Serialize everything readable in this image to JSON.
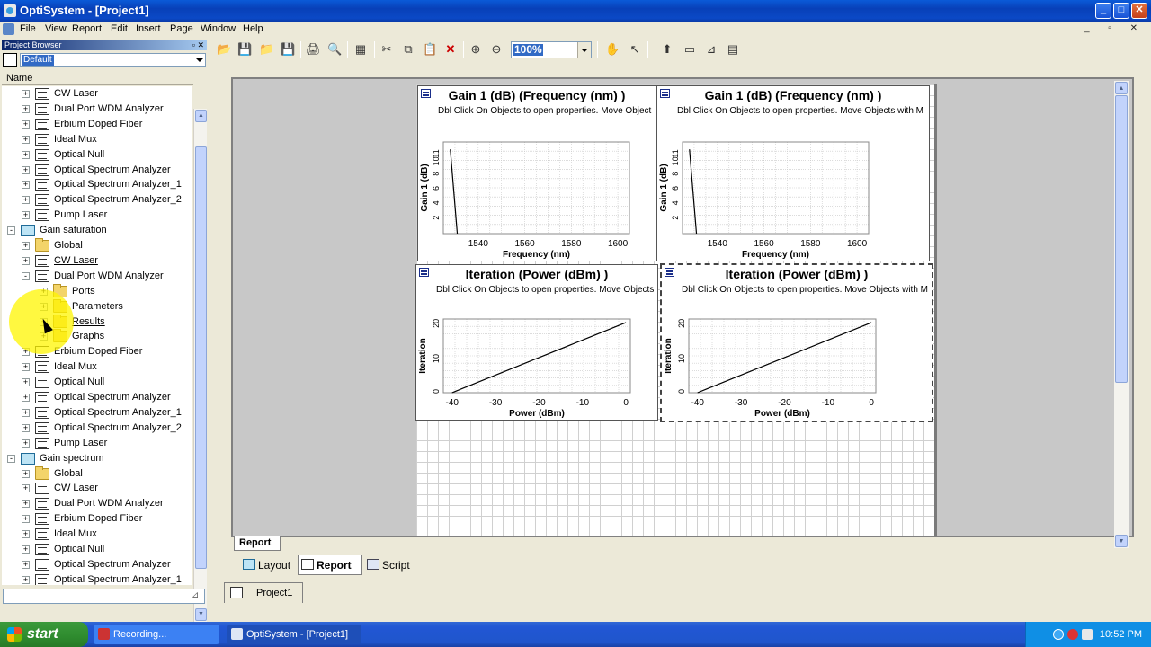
{
  "window": {
    "title": "OptiSystem - [Project1]"
  },
  "menu": [
    "File",
    "View",
    "Report",
    "Edit",
    "Insert",
    "Page",
    "Window",
    "Help"
  ],
  "browser": {
    "title": "Project Browser",
    "combo_value": "Default",
    "header": "Name",
    "rows": [
      {
        "label": "CW Laser",
        "level": 1,
        "icon": "laser-icon",
        "exp": "+"
      },
      {
        "label": "Dual Port WDM Analyzer",
        "level": 1,
        "icon": "analyzer-icon",
        "exp": "+"
      },
      {
        "label": "Erbium Doped Fiber",
        "level": 1,
        "icon": "fiber-icon",
        "exp": "+"
      },
      {
        "label": "Ideal Mux",
        "level": 1,
        "icon": "mux-icon",
        "exp": "+"
      },
      {
        "label": "Optical Null",
        "level": 1,
        "icon": "null-icon",
        "exp": "+"
      },
      {
        "label": "Optical Spectrum Analyzer",
        "level": 1,
        "icon": "analyzer-icon",
        "exp": "+"
      },
      {
        "label": "Optical Spectrum Analyzer_1",
        "level": 1,
        "icon": "analyzer-icon",
        "exp": "+"
      },
      {
        "label": "Optical Spectrum Analyzer_2",
        "level": 1,
        "icon": "analyzer-icon",
        "exp": "+"
      },
      {
        "label": "Pump Laser",
        "level": 1,
        "icon": "laser-icon",
        "exp": "+"
      },
      {
        "label": "Gain saturation",
        "level": 0,
        "icon": "layout-icon",
        "exp": "-"
      },
      {
        "label": "Global",
        "level": 1,
        "icon": "folder-icon",
        "exp": "+"
      },
      {
        "label": "CW Laser",
        "level": 1,
        "icon": "laser-icon",
        "exp": "+",
        "underline": true
      },
      {
        "label": "Dual Port WDM Analyzer",
        "level": 1,
        "icon": "analyzer-icon",
        "exp": "-"
      },
      {
        "label": "Ports",
        "level": 2,
        "icon": "folder-icon",
        "exp": "+"
      },
      {
        "label": "Parameters",
        "level": 2,
        "icon": "folder-icon",
        "exp": "+"
      },
      {
        "label": "Results",
        "level": 2,
        "icon": "folder-icon",
        "exp": "+",
        "underline": true
      },
      {
        "label": "Graphs",
        "level": 2,
        "icon": "folder-icon",
        "exp": "+"
      },
      {
        "label": "Erbium Doped Fiber",
        "level": 1,
        "icon": "fiber-icon",
        "exp": "+"
      },
      {
        "label": "Ideal Mux",
        "level": 1,
        "icon": "mux-icon",
        "exp": "+"
      },
      {
        "label": "Optical Null",
        "level": 1,
        "icon": "null-icon",
        "exp": "+"
      },
      {
        "label": "Optical Spectrum Analyzer",
        "level": 1,
        "icon": "analyzer-icon",
        "exp": "+"
      },
      {
        "label": "Optical Spectrum Analyzer_1",
        "level": 1,
        "icon": "analyzer-icon",
        "exp": "+"
      },
      {
        "label": "Optical Spectrum Analyzer_2",
        "level": 1,
        "icon": "analyzer-icon",
        "exp": "+"
      },
      {
        "label": "Pump Laser",
        "level": 1,
        "icon": "laser-icon",
        "exp": "+"
      },
      {
        "label": "Gain spectrum",
        "level": 0,
        "icon": "layout-icon",
        "exp": "-"
      },
      {
        "label": "Global",
        "level": 1,
        "icon": "folder-icon",
        "exp": "+"
      },
      {
        "label": "CW Laser",
        "level": 1,
        "icon": "laser-icon",
        "exp": "+"
      },
      {
        "label": "Dual Port WDM Analyzer",
        "level": 1,
        "icon": "analyzer-icon",
        "exp": "+"
      },
      {
        "label": "Erbium Doped Fiber",
        "level": 1,
        "icon": "fiber-icon",
        "exp": "+"
      },
      {
        "label": "Ideal Mux",
        "level": 1,
        "icon": "mux-icon",
        "exp": "+"
      },
      {
        "label": "Optical Null",
        "level": 1,
        "icon": "null-icon",
        "exp": "+"
      },
      {
        "label": "Optical Spectrum Analyzer",
        "level": 1,
        "icon": "analyzer-icon",
        "exp": "+"
      },
      {
        "label": "Optical Spectrum Analyzer_1",
        "level": 1,
        "icon": "analyzer-icon",
        "exp": "+"
      }
    ]
  },
  "toolbar": {
    "zoom": "100%"
  },
  "panels": {
    "gain_a": {
      "title": "Gain 1 (dB) (Frequency (nm) )",
      "hint": "Dbl Click On Objects to open properties.  Move Object"
    },
    "gain_b": {
      "title": "Gain 1 (dB) (Frequency (nm) )",
      "hint": "Dbl Click On Objects to open properties.  Move Objects with M"
    },
    "iter_a": {
      "title": "Iteration (Power (dBm) )",
      "hint": "Dbl Click On Objects to open properties.  Move Objects"
    },
    "iter_b": {
      "title": "Iteration (Power (dBm) )",
      "hint": "Dbl Click On Objects to open properties.  Move Objects with M"
    }
  },
  "chart_data": [
    {
      "type": "line",
      "xlabel": "Frequency (nm)",
      "ylabel": "Gain 1 (dB)",
      "xlim": [
        1525,
        1605
      ],
      "ylim": [
        0,
        12.5
      ],
      "xticks": [
        1540,
        1560,
        1580,
        1600
      ],
      "yticks": [
        2,
        4,
        6,
        8,
        10,
        11
      ],
      "grid": true,
      "x": [
        1528,
        1531
      ],
      "y": [
        11.5,
        0
      ]
    },
    {
      "type": "line",
      "xlabel": "Power (dBm)",
      "ylabel": "Iteration",
      "xlim": [
        -42,
        1
      ],
      "ylim": [
        0,
        21
      ],
      "xticks": [
        -40,
        -30,
        -20,
        -10,
        0
      ],
      "yticks": [
        0,
        10,
        20
      ],
      "grid": true,
      "x": [
        -40,
        -38,
        -30,
        -20,
        -10,
        0
      ],
      "y": [
        0,
        1,
        5,
        10,
        15,
        20
      ]
    }
  ],
  "tabs": {
    "report": "Report",
    "layout": "Layout",
    "report_view": "Report",
    "script": "Script",
    "doc": "Project1"
  },
  "taskbar": {
    "start": "start",
    "task1": "Recording...",
    "task2": "OptiSystem - [Project1]",
    "clock": "10:52 PM"
  }
}
